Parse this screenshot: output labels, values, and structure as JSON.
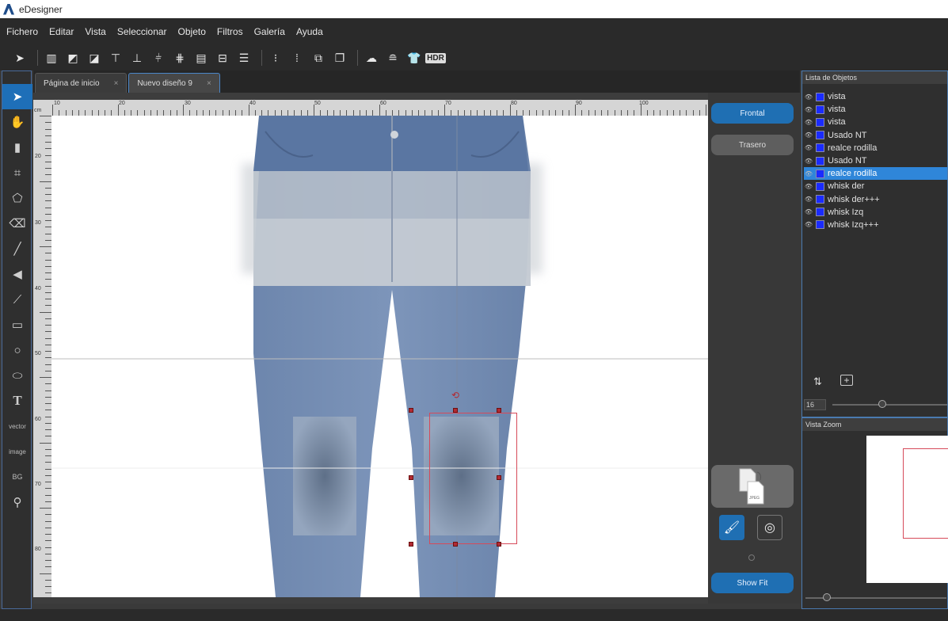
{
  "app": {
    "title": "eDesigner"
  },
  "menu": [
    "Fichero",
    "Editar",
    "Vista",
    "Seleccionar",
    "Objeto",
    "Filtros",
    "Galería",
    "Ayuda"
  ],
  "toolbar": {
    "hdr_label": "HDR"
  },
  "left_tools": {
    "vector_label": "vector",
    "image_label": "image",
    "bg_label": "BG",
    "text_label": "T"
  },
  "tabs": [
    {
      "label": "Página de inicio",
      "active": false
    },
    {
      "label": "Nuevo diseño 9",
      "active": true
    }
  ],
  "ruler": {
    "unit": "cm",
    "top_labels": [
      "10",
      "20",
      "30",
      "40",
      "50",
      "60",
      "70",
      "80",
      "90",
      "100"
    ],
    "left_labels": [
      "20",
      "30",
      "40",
      "50",
      "60",
      "70",
      "80"
    ]
  },
  "side_buttons": {
    "frontal": "Frontal",
    "trasero": "Trasero",
    "show_fit": "Show Fit",
    "doc_label": "JPEG"
  },
  "objects_panel": {
    "title": "Lista de Objetos",
    "items": [
      {
        "label": "vista",
        "selected": false
      },
      {
        "label": "vista",
        "selected": false
      },
      {
        "label": "vista",
        "selected": false
      },
      {
        "label": "Usado NT",
        "selected": false
      },
      {
        "label": "realce rodilla",
        "selected": false
      },
      {
        "label": "Usado NT",
        "selected": false
      },
      {
        "label": "realce rodilla",
        "selected": true
      },
      {
        "label": "whisk der",
        "selected": false
      },
      {
        "label": "whisk der+++",
        "selected": false
      },
      {
        "label": "whisk Izq",
        "selected": false
      },
      {
        "label": "whisk Izq+++",
        "selected": false
      }
    ],
    "size_value": "16",
    "swatch_color": "#1a2bff",
    "selection_color": "#2f86d9"
  },
  "zoom_panel": {
    "title": "Vista Zoom"
  }
}
